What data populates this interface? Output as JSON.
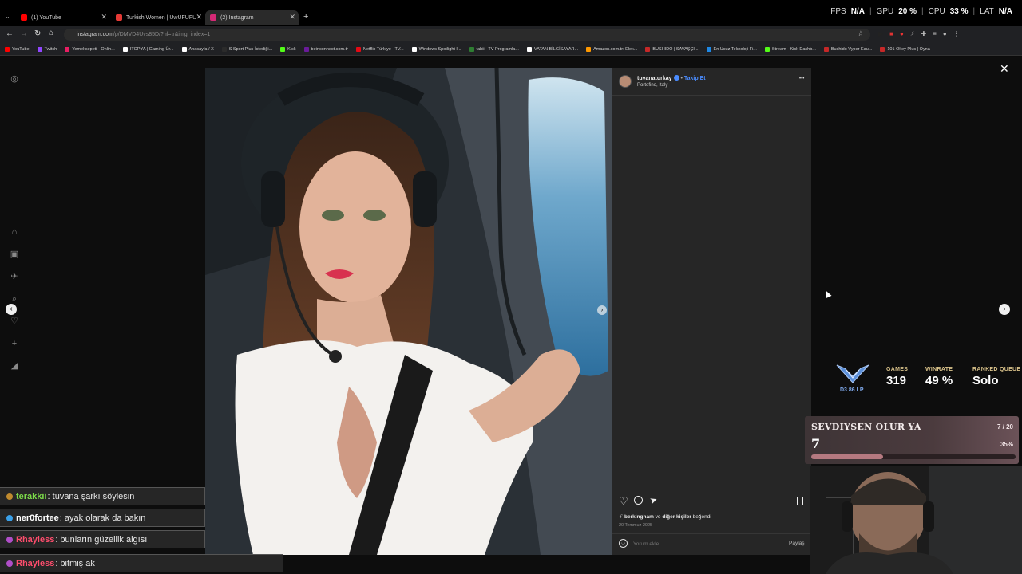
{
  "browser": {
    "tabs": [
      {
        "title": "(1) YouTube",
        "color": "#ff0000"
      },
      {
        "title": "Turkish Women | UwUFUFU",
        "color": "#e53935"
      },
      {
        "title": "(2) Instagram",
        "color": "#d62976"
      }
    ],
    "new_tab": "+",
    "url_main": "instagram.com",
    "url_rest": "/p/DMVD4Uvs85D/?hl=tr&img_index=1",
    "bookmarks": [
      {
        "label": "YouTube",
        "color": "#ff0000"
      },
      {
        "label": "Twitch",
        "color": "#9146ff"
      },
      {
        "label": "Yemeksepeti - Onlin...",
        "color": "#e91e63"
      },
      {
        "label": "ITOPYA | Gaming Ür...",
        "color": "#ffffff"
      },
      {
        "label": "Anasayfa / X",
        "color": "#ffffff"
      },
      {
        "label": "S Sport Plus-İstediği...",
        "color": "#2b2b2b"
      },
      {
        "label": "Kick",
        "color": "#53fc18"
      },
      {
        "label": "beinconnect.com.tr",
        "color": "#6a1b9a"
      },
      {
        "label": "Netflix Türkiye - TV...",
        "color": "#e50914"
      },
      {
        "label": "Windows Spotlight I...",
        "color": "#ffffff"
      },
      {
        "label": "tabii - TV Programla...",
        "color": "#2e7d32"
      },
      {
        "label": "VATAN BİLGİSAYAR...",
        "color": "#ffffff"
      },
      {
        "label": "Amazon.com.tr: Elek...",
        "color": "#ff9900"
      },
      {
        "label": "BUSHIDO | SAVAŞÇI...",
        "color": "#c62828"
      },
      {
        "label": "En Ucuz Teknoloji Fi...",
        "color": "#1e88e5"
      },
      {
        "label": "Stream - Kick Dashb...",
        "color": "#53fc18"
      },
      {
        "label": "Bushido Vyper Eau...",
        "color": "#c62828"
      },
      {
        "label": "101 Okey Plus | Oyna",
        "color": "#c62828"
      }
    ]
  },
  "hud": {
    "fps_label": "FPS",
    "fps_value": "N/A",
    "gpu_label": "GPU",
    "gpu_value": "20 %",
    "cpu_label": "CPU",
    "cpu_value": "33 %",
    "lat_label": "LAT",
    "lat_value": "N/A"
  },
  "post": {
    "username": "tuvanaturkay",
    "follow": "Takip Et",
    "location": "Portofino, Italy",
    "more": "•••",
    "likes_user": "berkingham",
    "likes_rest": "ve diğer kişiler beğendi",
    "likes_and": "ve",
    "likes_others": "diğer kişiler",
    "likes_suffix": "beğendi",
    "date": "20 Temmuz 2025",
    "comment_placeholder": "Yorum ekle...",
    "share": "Paylaş"
  },
  "stats": {
    "rank_text": "D3 86 LP",
    "games_label": "GAMES",
    "games_value": "319",
    "winrate_label": "WINRATE",
    "winrate_value": "49 %",
    "queue_label": "RANKED QUEUE",
    "queue_value": "Solo"
  },
  "song": {
    "title": "SEVDIYSEN OLUR YA",
    "count": "7 / 20",
    "current": "7",
    "percent_label": "35%",
    "progress": 0.35
  },
  "chat": [
    {
      "name": "terakkii",
      "message": ": tuvana şarkı söylesin",
      "color": "#7ddc4a",
      "badge": "#c08a2e"
    },
    {
      "name": "ner0fortee",
      "message": ": ayak olarak da bakın",
      "color": "#ffffff",
      "badge": "#3aa0e8"
    },
    {
      "name": "Rhayless",
      "message": ": bunların güzellik algısı",
      "color": "#ff4d6d",
      "badge": "#b04ec8"
    },
    {
      "name": "Rhayless",
      "message": ": bitmiş ak",
      "color": "#ff4d6d",
      "badge": "#b04ec8"
    }
  ],
  "colors": {
    "accent_blue": "#4a8cff",
    "panel_bg": "#262626",
    "song_bar": "#b57980"
  },
  "icons": {
    "close": "close-icon",
    "next": "chevron-right-icon",
    "prev": "chevron-left-icon",
    "heart": "heart-icon",
    "comment": "comment-icon",
    "share": "send-icon",
    "save": "bookmark-icon",
    "emoji": "emoji-icon"
  }
}
